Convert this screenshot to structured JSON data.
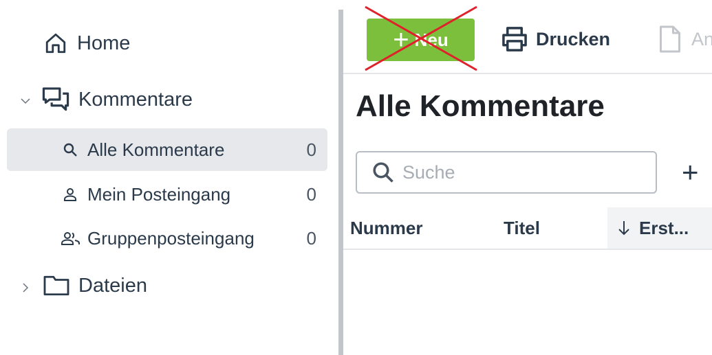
{
  "sidebar": {
    "home": {
      "label": "Home",
      "icon": "home-icon"
    },
    "comments": {
      "label": "Kommentare",
      "icon": "comments-icon",
      "expanded": true,
      "items": [
        {
          "label": "Alle Kommentare",
          "count": "0",
          "icon": "search-icon",
          "active": true
        },
        {
          "label": "Mein Posteingang",
          "count": "0",
          "icon": "user-icon",
          "active": false
        },
        {
          "label": "Gruppenposteingang",
          "count": "0",
          "icon": "users-icon",
          "active": false
        }
      ]
    },
    "files": {
      "label": "Dateien",
      "icon": "folder-icon",
      "expanded": false
    }
  },
  "toolbar": {
    "new_label": "Neu",
    "new_disabled_marker": "red-x-icon",
    "print_label": "Drucken",
    "other_label": "An"
  },
  "main": {
    "title": "Alle Kommentare",
    "search_placeholder": "Suche",
    "add_symbol": "+"
  },
  "table": {
    "columns": [
      "Nummer",
      "Titel",
      "Erst..."
    ],
    "sorted_column": "Erst...",
    "sort_direction": "desc"
  },
  "colors": {
    "accent_green": "#7cbf3c",
    "active_row_bg": "#e6e8eb",
    "cross_red": "#e0202a",
    "text": "#2b3a4a"
  }
}
